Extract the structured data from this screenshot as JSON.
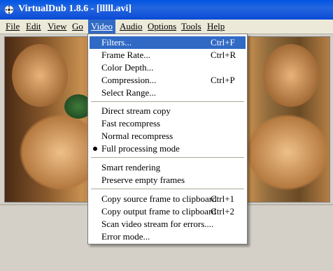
{
  "window": {
    "title": "VirtualDub 1.8.6 - [lllll.avi]"
  },
  "menubar": [
    "File",
    "Edit",
    "View",
    "Go",
    "Video",
    "Audio",
    "Options",
    "Tools",
    "Help"
  ],
  "menu": {
    "items": [
      {
        "label": "Filters...",
        "shortcut": "Ctrl+F"
      },
      {
        "label": "Frame Rate...",
        "shortcut": "Ctrl+R"
      },
      {
        "label": "Color Depth...",
        "shortcut": ""
      },
      {
        "label": "Compression...",
        "shortcut": "Ctrl+P"
      },
      {
        "label": "Select Range...",
        "shortcut": ""
      },
      {
        "label": "Direct stream copy",
        "shortcut": ""
      },
      {
        "label": "Fast recompress",
        "shortcut": ""
      },
      {
        "label": "Normal recompress",
        "shortcut": ""
      },
      {
        "label": "Full processing mode",
        "shortcut": ""
      },
      {
        "label": "Smart rendering",
        "shortcut": ""
      },
      {
        "label": "Preserve empty frames",
        "shortcut": ""
      },
      {
        "label": "Copy source frame to clipboard",
        "shortcut": "Ctrl+1"
      },
      {
        "label": "Copy output frame to clipboard",
        "shortcut": "Ctrl+2"
      },
      {
        "label": "Scan video stream for errors....",
        "shortcut": ""
      },
      {
        "label": "Error mode...",
        "shortcut": ""
      }
    ]
  },
  "colors": {
    "highlight": "#316ac5",
    "titlebar": "#0054e3",
    "menu_bg": "#ffffff",
    "window_bg": "#d4d0c8"
  },
  "icons": {
    "app": "virtualdub-icon",
    "radio": "bullet-icon"
  }
}
